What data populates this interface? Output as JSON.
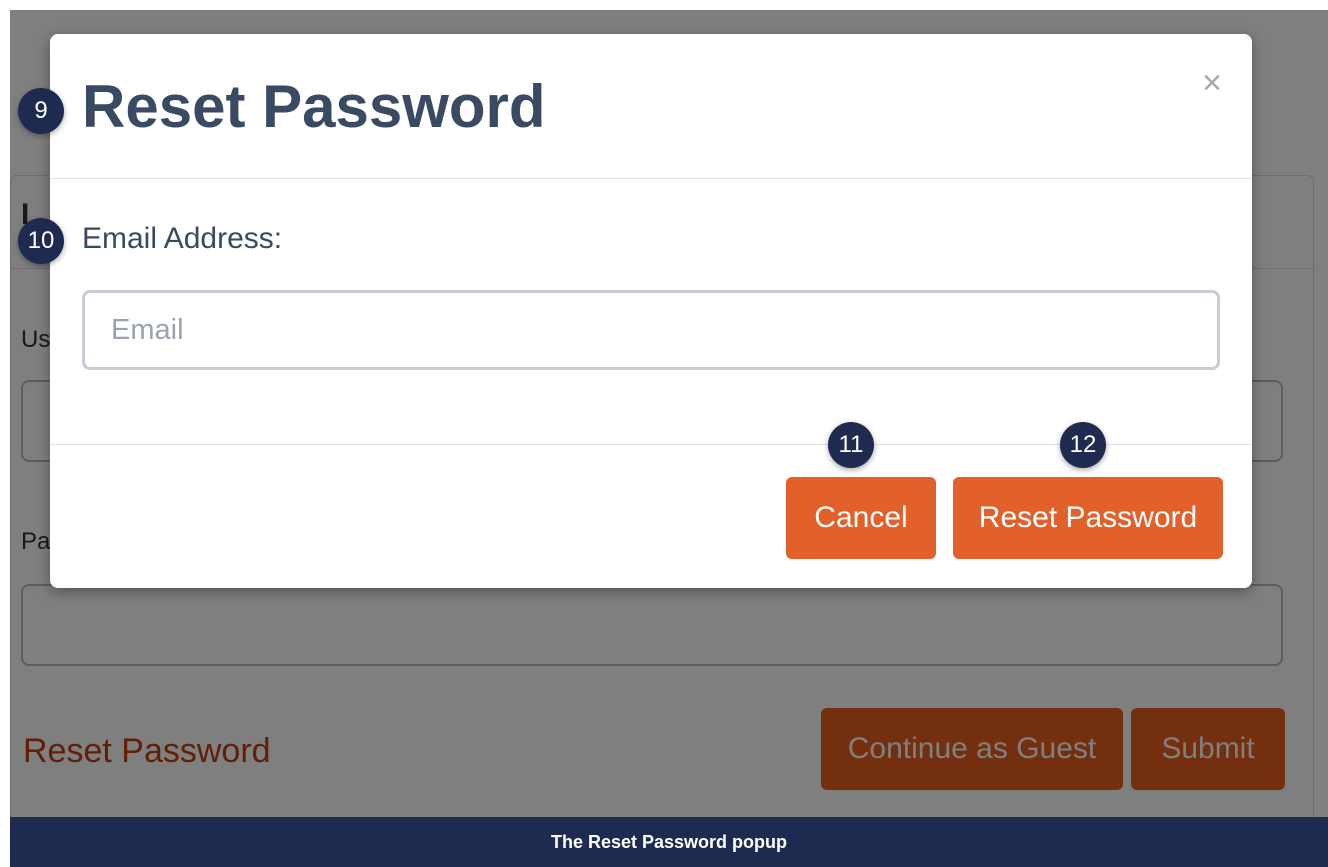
{
  "background": {
    "card_title": "I",
    "username_label": "Us",
    "password_label": "Pa",
    "reset_link": "Reset Password",
    "guest_button": "Continue as Guest",
    "submit_button": "Submit"
  },
  "modal": {
    "title": "Reset Password",
    "close_symbol": "×",
    "email_label": "Email Address:",
    "email_placeholder": "Email",
    "email_value": "",
    "cancel_label": "Cancel",
    "reset_label": "Reset Password"
  },
  "callouts": [
    "9",
    "10",
    "11",
    "12"
  ],
  "caption": "The Reset Password popup",
  "colors": {
    "accent": "#e2602a",
    "title": "#3b4a63",
    "badge": "#1e2a4f"
  }
}
